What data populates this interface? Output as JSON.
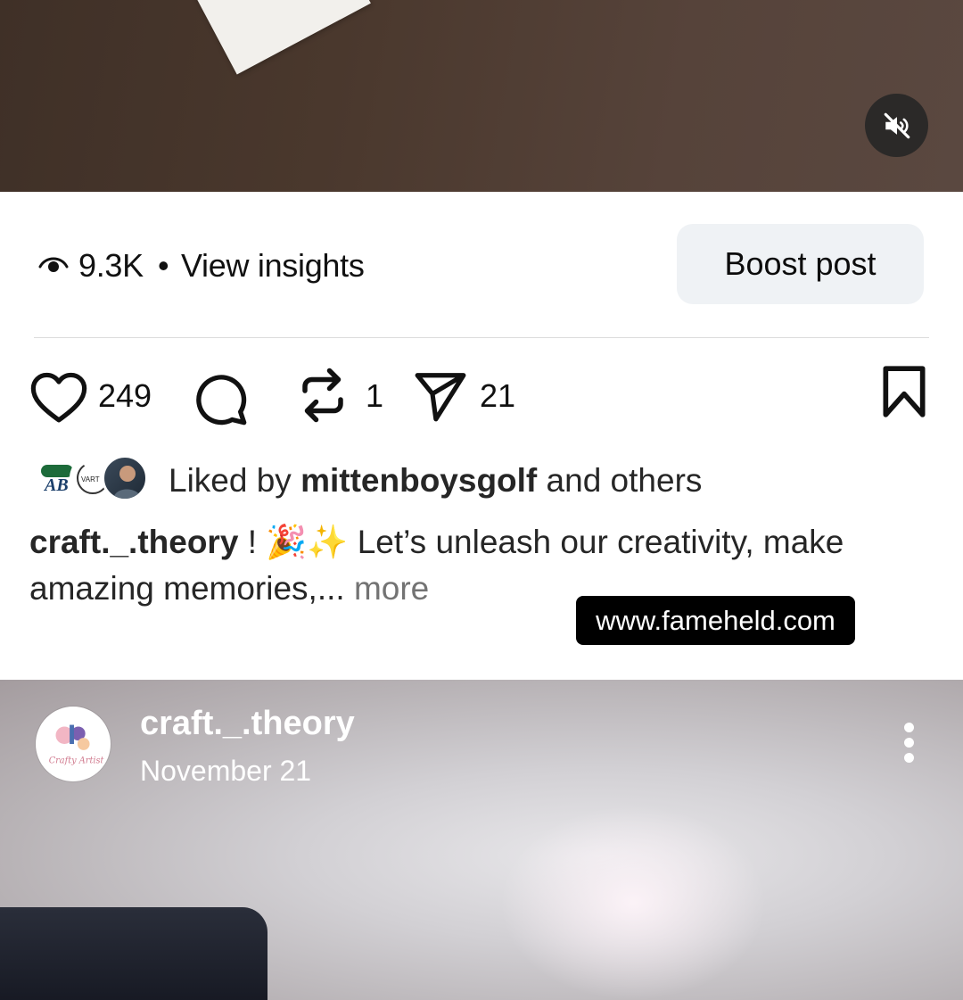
{
  "insights": {
    "views": "9.3K",
    "separator": "•",
    "view_insights_label": "View insights",
    "boost_label": "Boost post"
  },
  "actions": {
    "likes": "249",
    "reposts": "1",
    "shares": "21",
    "icons": [
      "heart-icon",
      "comment-icon",
      "repost-icon",
      "share-icon",
      "bookmark-icon"
    ]
  },
  "liked_by": {
    "prefix": "Liked by",
    "user": "mittenboysgolf",
    "suffix": "and others",
    "avatar_texts": [
      "AB",
      "VART"
    ]
  },
  "caption": {
    "username": "craft._.theory",
    "text_before_emoji": "!",
    "emojis": "🎉✨",
    "text": "Let’s unleash our creativity, make amazing memories,...",
    "more": "more"
  },
  "watermark": "www.fameheld.com",
  "next_post": {
    "author": "craft._.theory",
    "date": "November 21",
    "avatar_text": "Crafty Artist"
  },
  "colors": {
    "boost_bg": "#eff2f5",
    "more_text": "#737373",
    "mute_bg": "#2b2928"
  }
}
